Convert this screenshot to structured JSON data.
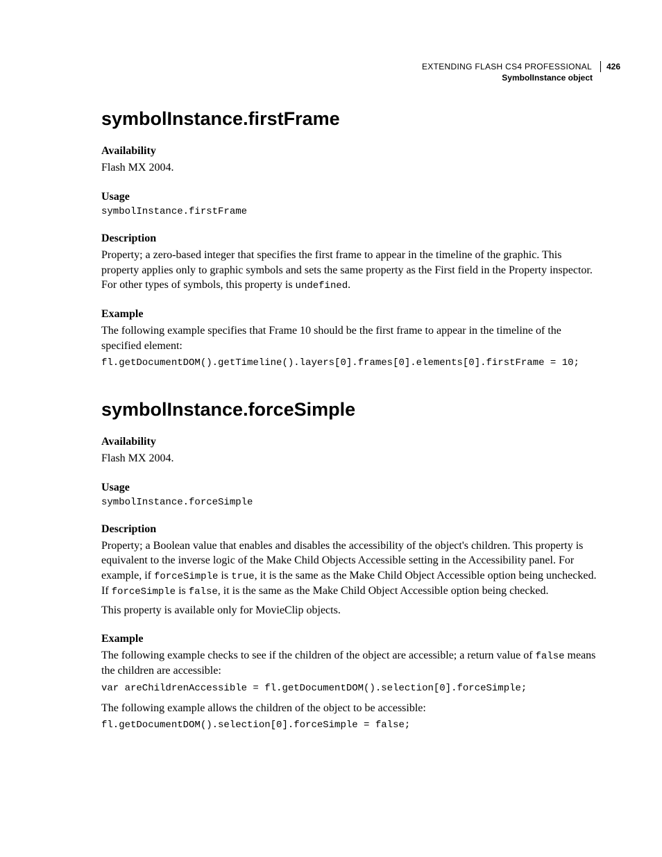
{
  "header": {
    "book_title": "EXTENDING FLASH CS4 PROFESSIONAL",
    "chapter": "SymbolInstance object",
    "page_number": "426"
  },
  "sections": [
    {
      "title": "symbolInstance.firstFrame",
      "availability_label": "Availability",
      "availability_text": "Flash MX 2004.",
      "usage_label": "Usage",
      "usage_code": "symbolInstance.firstFrame",
      "description_label": "Description",
      "description_pre": "Property; a zero-based integer that specifies the first frame to appear in the timeline of the graphic. This property applies only to graphic symbols and sets the same property as the First field in the Property inspector. For other types of symbols, this property is ",
      "description_code": "undefined",
      "description_post": ".",
      "example_label": "Example",
      "example_text": "The following example specifies that Frame 10 should be the first frame to appear in the timeline of the specified element:",
      "example_code": "fl.getDocumentDOM().getTimeline().layers[0].frames[0].elements[0].firstFrame = 10;"
    },
    {
      "title": "symbolInstance.forceSimple",
      "availability_label": "Availability",
      "availability_text": "Flash MX 2004.",
      "usage_label": "Usage",
      "usage_code": "symbolInstance.forceSimple",
      "description_label": "Description",
      "desc_pre1": "Property; a Boolean value that enables and disables the accessibility of the object's children. This property is equivalent to the inverse logic of the Make Child Objects Accessible setting in the Accessibility panel. For example, if ",
      "desc_code1": "forceSimple",
      "desc_mid1": " is ",
      "desc_code2": "true",
      "desc_mid2": ", it is the same as the Make Child Object Accessible option being unchecked. If ",
      "desc_code3": "forceSimple",
      "desc_mid3": " is ",
      "desc_code4": "false",
      "desc_post": ", it is the same as the Make Child Object Accessible option being checked.",
      "desc_note": "This property is available only for MovieClip objects.",
      "example_label": "Example",
      "example_text1_pre": "The following example checks to see if the children of the object are accessible; a return value of ",
      "example_text1_code": "false",
      "example_text1_post": " means the children are accessible:",
      "example_code1": "var areChildrenAccessible = fl.getDocumentDOM().selection[0].forceSimple;",
      "example_text2": "The following example allows the children of the object to be accessible:",
      "example_code2": "fl.getDocumentDOM().selection[0].forceSimple = false;"
    }
  ]
}
